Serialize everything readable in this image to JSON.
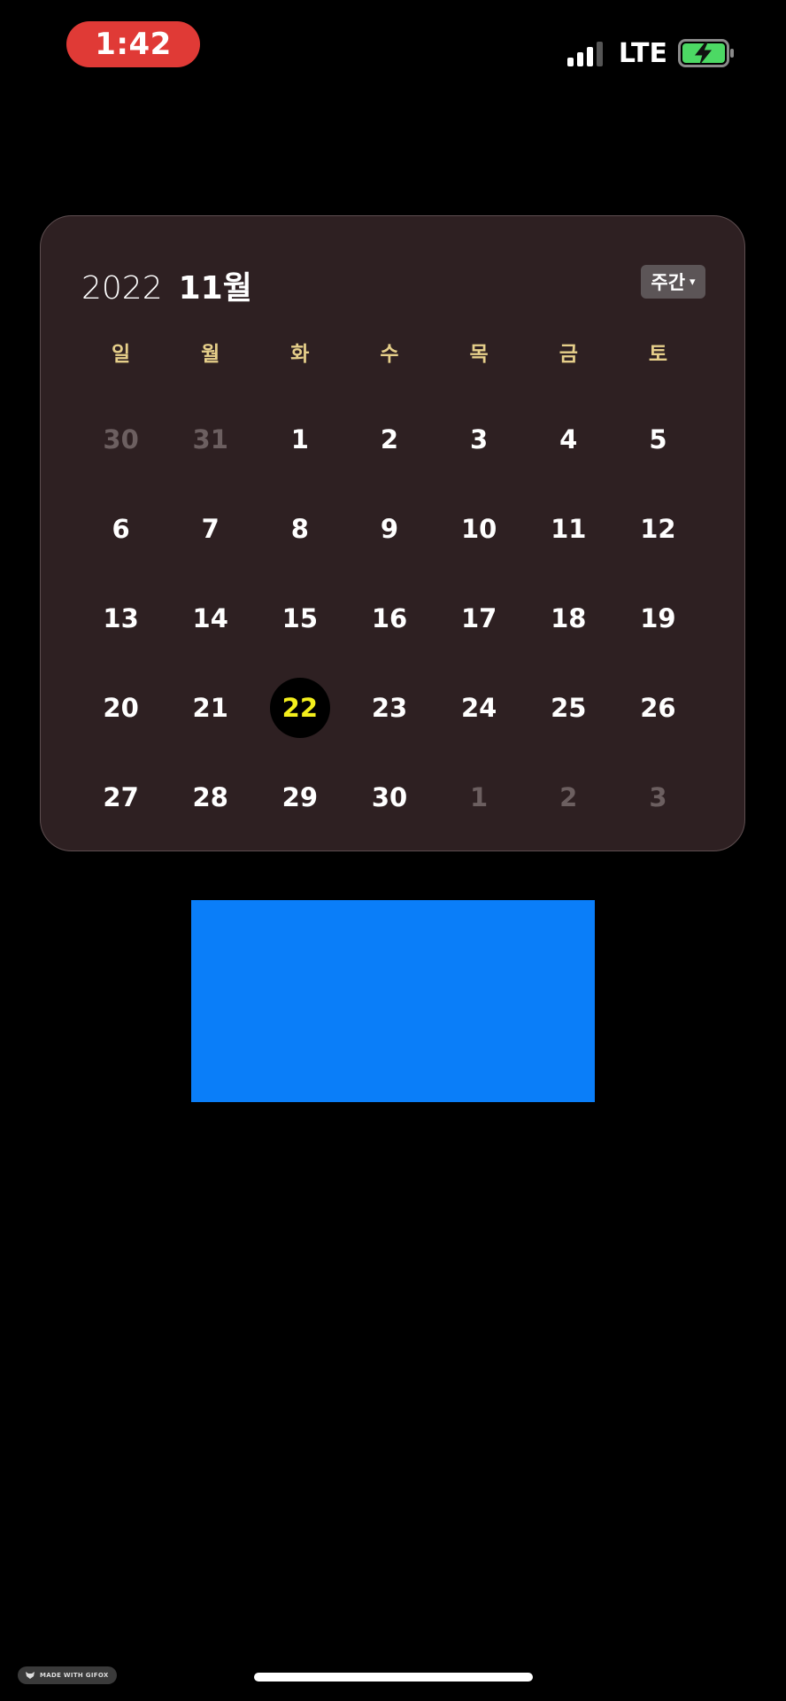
{
  "status_bar": {
    "time": "1:42",
    "network": "LTE",
    "time_pill_color": "#e03a36",
    "battery_color": "#4cd964",
    "icons": [
      "signal-icon",
      "battery-charging-icon"
    ]
  },
  "calendar": {
    "year": "2022",
    "month": "11월",
    "view_toggle": {
      "label": "주간",
      "caret": "▾"
    },
    "weekdays": [
      "일",
      "월",
      "화",
      "수",
      "목",
      "금",
      "토"
    ],
    "today": "22",
    "today_color": "#f4ef1c",
    "weeks": [
      [
        {
          "d": "30",
          "muted": true
        },
        {
          "d": "31",
          "muted": true
        },
        {
          "d": "1"
        },
        {
          "d": "2"
        },
        {
          "d": "3"
        },
        {
          "d": "4"
        },
        {
          "d": "5"
        }
      ],
      [
        {
          "d": "6"
        },
        {
          "d": "7"
        },
        {
          "d": "8"
        },
        {
          "d": "9"
        },
        {
          "d": "10"
        },
        {
          "d": "11"
        },
        {
          "d": "12"
        }
      ],
      [
        {
          "d": "13"
        },
        {
          "d": "14"
        },
        {
          "d": "15"
        },
        {
          "d": "16"
        },
        {
          "d": "17"
        },
        {
          "d": "18"
        },
        {
          "d": "19"
        }
      ],
      [
        {
          "d": "20"
        },
        {
          "d": "21"
        },
        {
          "d": "22",
          "today": true
        },
        {
          "d": "23"
        },
        {
          "d": "24"
        },
        {
          "d": "25"
        },
        {
          "d": "26"
        }
      ],
      [
        {
          "d": "27"
        },
        {
          "d": "28"
        },
        {
          "d": "29"
        },
        {
          "d": "30"
        },
        {
          "d": "1",
          "muted": true
        },
        {
          "d": "2",
          "muted": true
        },
        {
          "d": "3",
          "muted": true
        }
      ]
    ]
  },
  "blue_block": {
    "color": "#0a7ef9"
  },
  "watermark": {
    "label": "MADE WITH GIFOX"
  }
}
